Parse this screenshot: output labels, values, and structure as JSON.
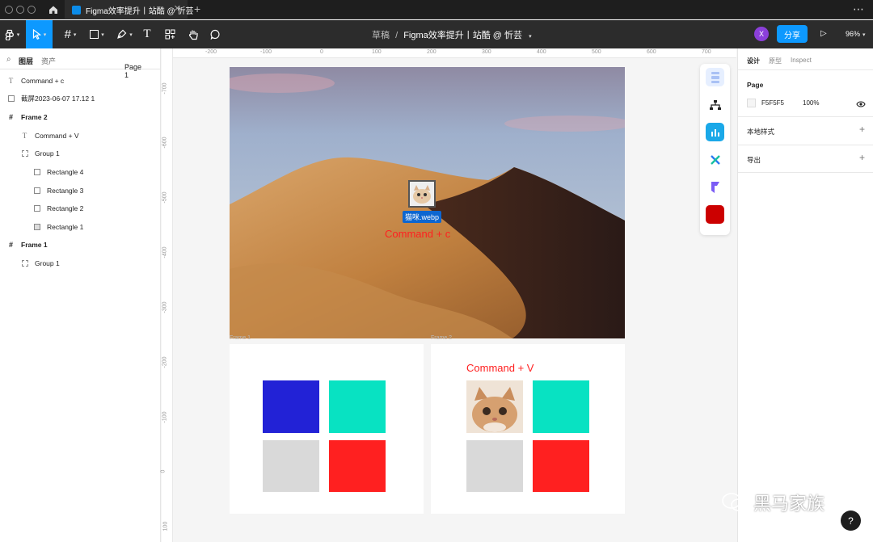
{
  "titlebar": {
    "tab_title": "Figma效率提升丨站酷 @ 忻芸",
    "close": "✕",
    "new_tab": "+",
    "more": "⋯"
  },
  "toolbar": {
    "crumb_project": "草稿",
    "crumb_sep": "/",
    "crumb_file": "Figma效率提升丨站酷 @ 忻芸",
    "avatar_letter": "X",
    "share_label": "分享",
    "zoom": "96%"
  },
  "left": {
    "tab_layers": "图层",
    "tab_assets": "资产",
    "page_selector": "Page 1",
    "layers": [
      {
        "label": "Command + c"
      },
      {
        "label": "截屏2023-06-07 17.12 1"
      },
      {
        "label": "Frame 2"
      },
      {
        "label": "Command + V"
      },
      {
        "label": "Group 1"
      },
      {
        "label": "Rectangle 4"
      },
      {
        "label": "Rectangle 3"
      },
      {
        "label": "Rectangle 2"
      },
      {
        "label": "Rectangle 1"
      },
      {
        "label": "Frame 1"
      },
      {
        "label": "Group 1"
      }
    ]
  },
  "rulers": {
    "h": [
      "-200",
      "-100",
      "0",
      "100",
      "200",
      "300",
      "400",
      "500",
      "600",
      "700"
    ],
    "v": [
      "-700",
      "-600",
      "-500",
      "-400",
      "-300",
      "-200",
      "-100",
      "0",
      "100"
    ]
  },
  "canvas": {
    "frame1_label": "Frame 1",
    "frame2_label": "Frame 2",
    "copied_label": "Command + c",
    "pasted_label": "Command + V",
    "dragged_file": "猫咪.webp",
    "colors": {
      "blue": "#2222d6",
      "teal": "#08e2c2",
      "gray": "#d9d9d9",
      "red": "#ff2020"
    }
  },
  "right": {
    "tab_design": "设计",
    "tab_prototype": "原型",
    "tab_inspect": "Inspect",
    "page_heading": "Page",
    "page_color": "F5F5F5",
    "page_opacity": "100%",
    "local_styles": "本地样式",
    "export": "导出"
  },
  "watermark": "黑马家族",
  "help": "?"
}
